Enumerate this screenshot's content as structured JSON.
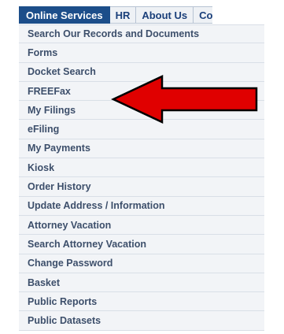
{
  "nav": {
    "tabs": [
      {
        "label": "Online Services"
      },
      {
        "label": "HR"
      },
      {
        "label": "About Us"
      },
      {
        "label": "Co"
      }
    ]
  },
  "menu": {
    "items": [
      {
        "label": "Search Our Records and Documents"
      },
      {
        "label": "Forms"
      },
      {
        "label": "Docket Search"
      },
      {
        "label": "FREEFax"
      },
      {
        "label": "My Filings"
      },
      {
        "label": "eFiling"
      },
      {
        "label": "My Payments"
      },
      {
        "label": "Kiosk"
      },
      {
        "label": "Order History"
      },
      {
        "label": "Update Address / Information"
      },
      {
        "label": "Attorney Vacation"
      },
      {
        "label": "Search Attorney Vacation"
      },
      {
        "label": "Change Password"
      },
      {
        "label": "Basket"
      },
      {
        "label": "Public Reports"
      },
      {
        "label": "Public Datasets"
      }
    ]
  },
  "annotation": {
    "arrow_icon": "left-arrow-icon",
    "arrow_color": "#e00000",
    "arrow_outline": "#000000"
  },
  "colors": {
    "active_tab_bg": "#1c4e8a",
    "menu_bg": "#f2f4f7",
    "menu_text": "#3d4f6b"
  }
}
